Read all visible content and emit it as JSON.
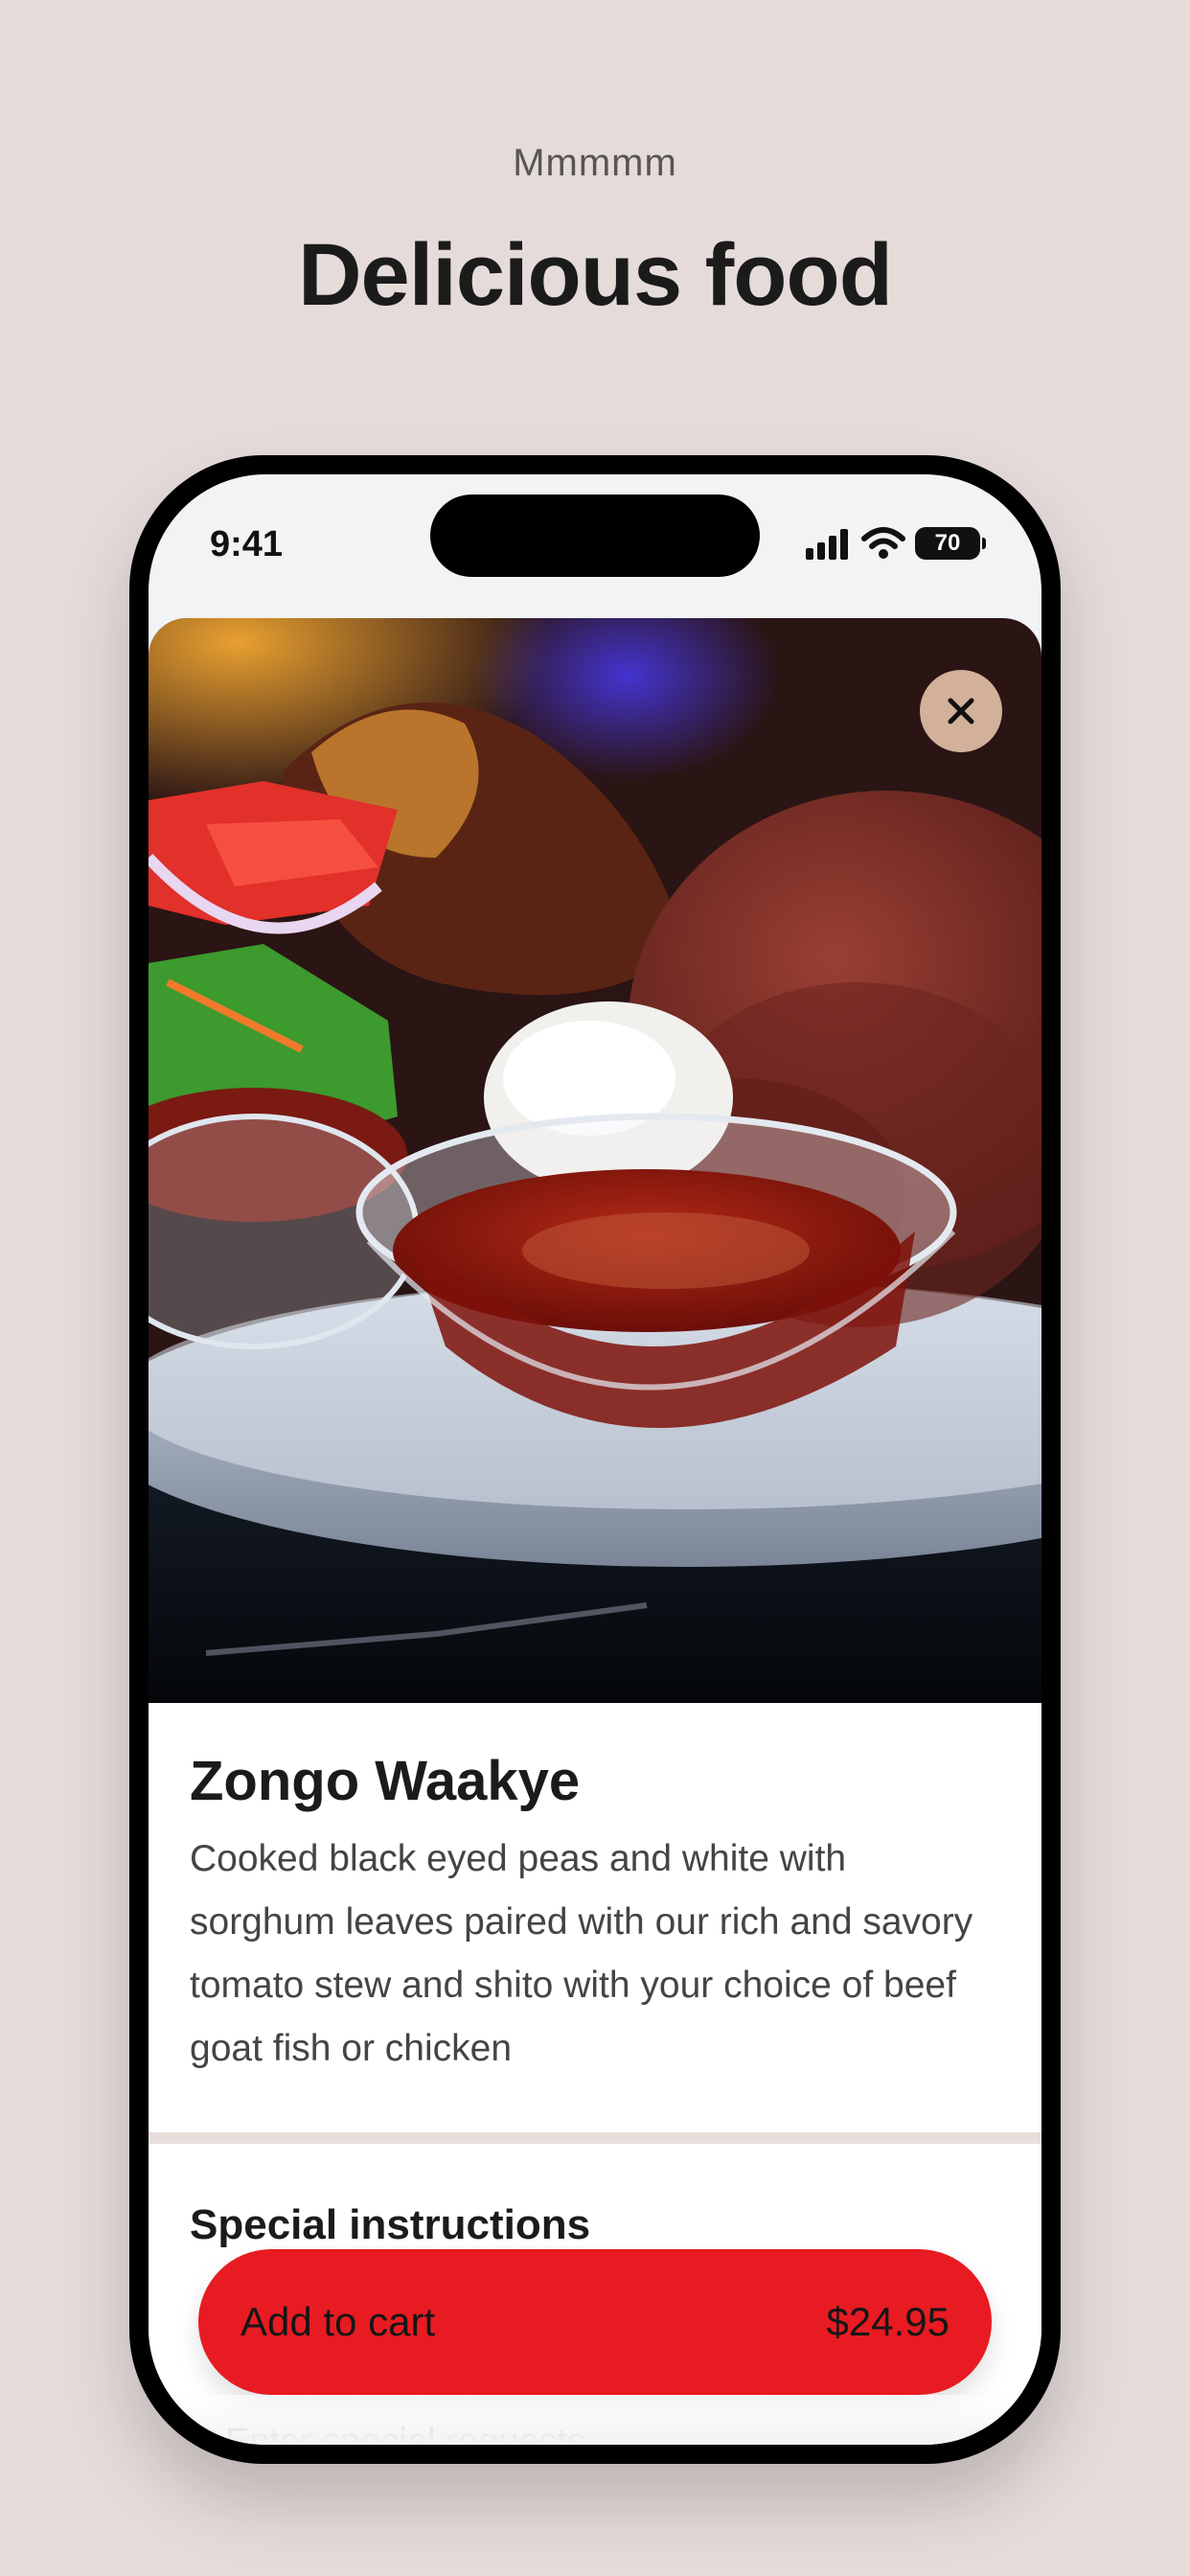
{
  "promo": {
    "eyebrow": "Mmmmm",
    "headline": "Delicious food"
  },
  "status_bar": {
    "time": "9:41",
    "battery_level": "70"
  },
  "item": {
    "image_alt": "Plate of waakye with stew, boiled egg, salad and fried fish",
    "name": "Zongo Waakye",
    "description": "Cooked black eyed peas and white with sorghum leaves paired with our rich and savory tomato stew and shito with your choice of beef goat fish or chicken"
  },
  "special_instructions": {
    "title": "Special instructions",
    "placeholder": "Enter special requests"
  },
  "cart": {
    "button_label": "Add to cart",
    "price": "$24.95"
  },
  "colors": {
    "background": "#e5dcda",
    "accent": "#e81b22",
    "close_button": "#e1bea5"
  },
  "icons": [
    "signal-icon",
    "wifi-icon",
    "battery-icon",
    "close-icon"
  ]
}
